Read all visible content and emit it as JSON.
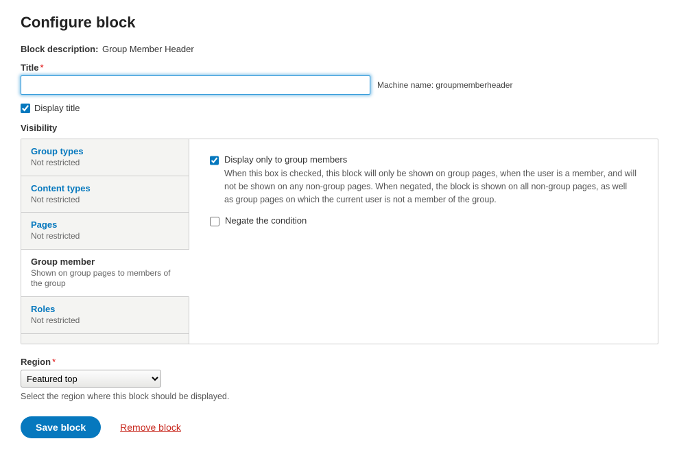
{
  "page": {
    "title": "Configure block"
  },
  "block_description": {
    "label": "Block description:",
    "value": "Group Member Header"
  },
  "title_field": {
    "label": "Title",
    "value": "",
    "machine_name_label": "Machine name:",
    "machine_name_value": "groupmemberheader"
  },
  "display_title": {
    "label": "Display title",
    "checked": true
  },
  "visibility": {
    "label": "Visibility",
    "tabs": [
      {
        "title": "Group types",
        "summary": "Not restricted"
      },
      {
        "title": "Content types",
        "summary": "Not restricted"
      },
      {
        "title": "Pages",
        "summary": "Not restricted"
      },
      {
        "title": "Group member",
        "summary": "Shown on group pages to members of the group"
      },
      {
        "title": "Roles",
        "summary": "Not restricted"
      }
    ],
    "active_tab": 3,
    "content": {
      "only_members": {
        "label": "Display only to group members",
        "checked": true,
        "description": "When this box is checked, this block will only be shown on group pages, when the user is a member, and will not be shown on any non-group pages. When negated, the block is shown on all non-group pages, as well as group pages on which the current user is not a member of the group."
      },
      "negate": {
        "label": "Negate the condition",
        "checked": false
      }
    }
  },
  "region": {
    "label": "Region",
    "value": "Featured top",
    "help": "Select the region where this block should be displayed."
  },
  "actions": {
    "save": "Save block",
    "remove": "Remove block"
  }
}
